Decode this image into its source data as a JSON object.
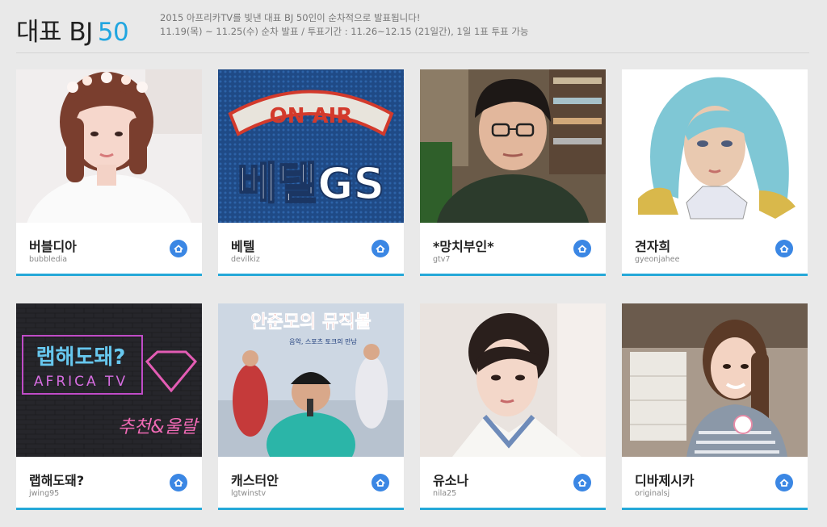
{
  "header": {
    "title": "대표 BJ",
    "title_number": "50",
    "desc_line1": "2015 아프리카TV를 빛낸 대표 BJ 50인이 순차적으로 발표됩니다!",
    "desc_line2": "11.19(목) ~ 11.25(수) 순차 발표 / 투표기간 : 11.26~12.15 (21일간), 1일 1표 투표 가능"
  },
  "colors": {
    "accent": "#21a6e0",
    "button": "#3b87e4",
    "card_border": "#25a8d8"
  },
  "cards": [
    {
      "name": "버블디아",
      "id": "bubbledia",
      "icon": "home-icon"
    },
    {
      "name": "베텔",
      "id": "devilkiz",
      "icon": "home-icon",
      "thumb_text": {
        "badge": "ON AIR",
        "logo": "베텔GS"
      }
    },
    {
      "name": "*망치부인*",
      "id": "gtv7",
      "icon": "home-icon"
    },
    {
      "name": "견자희",
      "id": "gyeonjahee",
      "icon": "home-icon"
    },
    {
      "name": "랩해도돼?",
      "id": "jwing95",
      "icon": "home-icon",
      "thumb_text": {
        "title": "랩해도돼?",
        "sub": "AFRICA TV",
        "tag": "추천&울랄"
      }
    },
    {
      "name": "캐스터안",
      "id": "lgtwinstv",
      "icon": "home-icon",
      "thumb_text": {
        "title": "안준모의 뮤직볼",
        "sub": "음악, 스포츠 토크의 만남"
      }
    },
    {
      "name": "유소나",
      "id": "nila25",
      "icon": "home-icon"
    },
    {
      "name": "디바제시카",
      "id": "originalsj",
      "icon": "home-icon"
    }
  ]
}
